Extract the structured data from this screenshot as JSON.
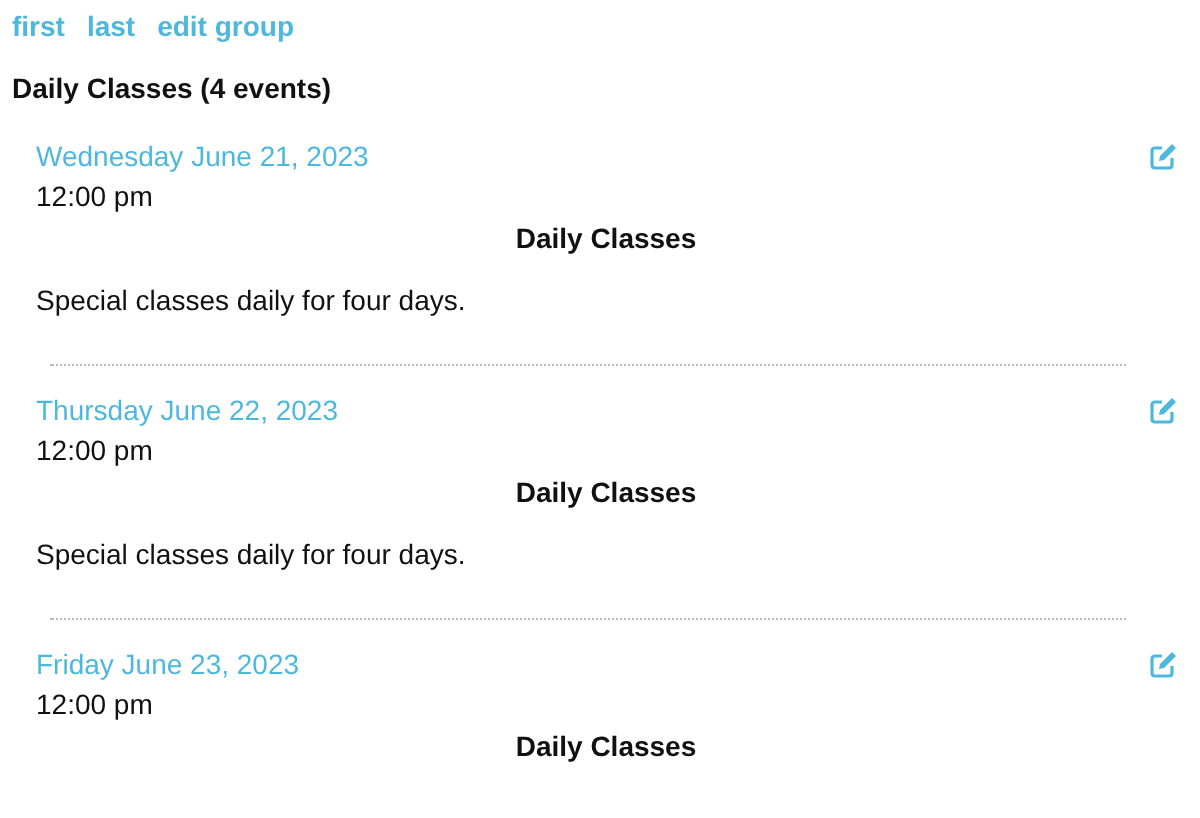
{
  "nav_links": [
    "first",
    "last",
    "edit group"
  ],
  "heading": "Daily Classes (4 events)",
  "events": [
    {
      "date": "Wednesday June 21, 2023",
      "time": "12:00 pm",
      "title": "Daily Classes",
      "description": "Special classes daily for four days."
    },
    {
      "date": "Thursday June 22, 2023",
      "time": "12:00 pm",
      "title": "Daily Classes",
      "description": "Special classes daily for four days."
    },
    {
      "date": "Friday June 23, 2023",
      "time": "12:00 pm",
      "title": "Daily Classes"
    }
  ]
}
